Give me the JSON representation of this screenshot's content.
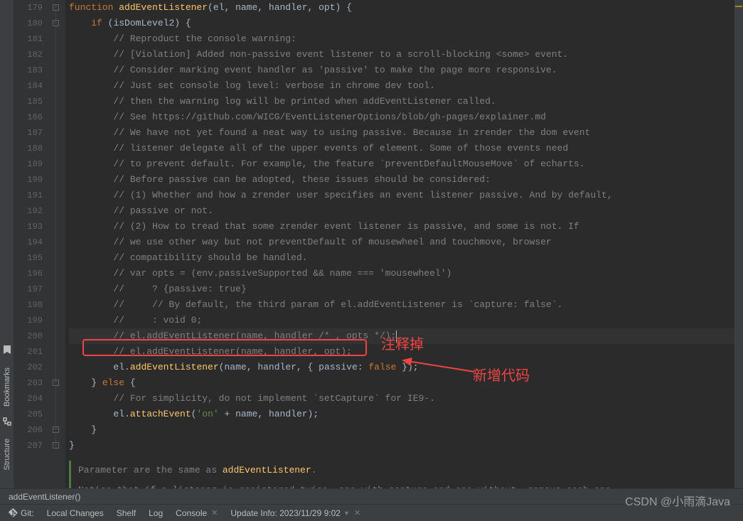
{
  "sidebar": {
    "bookmarks_label": "Bookmarks",
    "structure_label": "Structure"
  },
  "gutter": {
    "start": 179,
    "end": 207
  },
  "code": {
    "lines": [
      {
        "n": 179,
        "ind": 0,
        "t": [
          {
            "c": "kw",
            "v": "function "
          },
          {
            "c": "fn",
            "v": "addEventListener"
          },
          {
            "c": "punct",
            "v": "("
          },
          {
            "c": "param",
            "v": "el"
          },
          {
            "c": "punct",
            "v": ", "
          },
          {
            "c": "param",
            "v": "name"
          },
          {
            "c": "punct",
            "v": ", "
          },
          {
            "c": "param",
            "v": "handler"
          },
          {
            "c": "punct",
            "v": ", "
          },
          {
            "c": "param",
            "v": "opt"
          },
          {
            "c": "punct",
            "v": ") {"
          }
        ]
      },
      {
        "n": 180,
        "ind": 1,
        "t": [
          {
            "c": "kw",
            "v": "if "
          },
          {
            "c": "punct",
            "v": "("
          },
          {
            "c": "param",
            "v": "isDomLevel2"
          },
          {
            "c": "punct",
            "v": ") {"
          }
        ]
      },
      {
        "n": 181,
        "ind": 2,
        "t": [
          {
            "c": "comment",
            "v": "// Reproduct the console warning:"
          }
        ]
      },
      {
        "n": 182,
        "ind": 2,
        "t": [
          {
            "c": "comment",
            "v": "// [Violation] Added non-passive event listener to a scroll-blocking <some> event."
          }
        ]
      },
      {
        "n": 183,
        "ind": 2,
        "t": [
          {
            "c": "comment",
            "v": "// Consider marking event handler as 'passive' to make the page more responsive."
          }
        ]
      },
      {
        "n": 184,
        "ind": 2,
        "t": [
          {
            "c": "comment",
            "v": "// Just set console log level: verbose in chrome dev tool."
          }
        ]
      },
      {
        "n": 185,
        "ind": 2,
        "t": [
          {
            "c": "comment",
            "v": "// then the warning log will be printed when addEventListener called."
          }
        ]
      },
      {
        "n": 186,
        "ind": 2,
        "t": [
          {
            "c": "comment",
            "v": "// See https://github.com/WICG/EventListenerOptions/blob/gh-pages/explainer.md"
          }
        ]
      },
      {
        "n": 187,
        "ind": 2,
        "t": [
          {
            "c": "comment",
            "v": "// We have not yet found a neat way to using passive. Because in zrender the dom event"
          }
        ]
      },
      {
        "n": 188,
        "ind": 2,
        "t": [
          {
            "c": "comment",
            "v": "// listener delegate all of the upper events of element. Some of those events need"
          }
        ]
      },
      {
        "n": 189,
        "ind": 2,
        "t": [
          {
            "c": "comment",
            "v": "// to prevent default. For example, the feature `preventDefaultMouseMove` of echarts."
          }
        ]
      },
      {
        "n": 190,
        "ind": 2,
        "t": [
          {
            "c": "comment",
            "v": "// Before passive can be adopted, these issues should be considered:"
          }
        ]
      },
      {
        "n": 191,
        "ind": 2,
        "t": [
          {
            "c": "comment",
            "v": "// (1) Whether and how a zrender user specifies an event listener passive. And by default,"
          }
        ]
      },
      {
        "n": 192,
        "ind": 2,
        "t": [
          {
            "c": "comment",
            "v": "// passive or not."
          }
        ]
      },
      {
        "n": 193,
        "ind": 2,
        "t": [
          {
            "c": "comment",
            "v": "// (2) How to tread that some zrender event listener is passive, and some is not. If"
          }
        ]
      },
      {
        "n": 194,
        "ind": 2,
        "t": [
          {
            "c": "comment",
            "v": "// we use other way but not preventDefault of mousewheel and touchmove, browser"
          }
        ]
      },
      {
        "n": 195,
        "ind": 2,
        "t": [
          {
            "c": "comment",
            "v": "// compatibility should be handled."
          }
        ]
      },
      {
        "n": 196,
        "ind": 2,
        "t": [
          {
            "c": "comment",
            "v": "// var opts = (env.passiveSupported && name === 'mousewheel')"
          }
        ]
      },
      {
        "n": 197,
        "ind": 2,
        "t": [
          {
            "c": "comment",
            "v": "//     ? {passive: true}"
          }
        ]
      },
      {
        "n": 198,
        "ind": 2,
        "t": [
          {
            "c": "comment",
            "v": "//     // By default, the third param of el.addEventListener is `capture: false`."
          }
        ]
      },
      {
        "n": 199,
        "ind": 2,
        "t": [
          {
            "c": "comment",
            "v": "//     : void 0;"
          }
        ]
      },
      {
        "n": 200,
        "ind": 2,
        "current": true,
        "t": [
          {
            "c": "comment",
            "v": "// el.addEventListener(name, handler /* , opts */);"
          }
        ],
        "cursor": true
      },
      {
        "n": 201,
        "ind": 2,
        "t": [
          {
            "c": "comment",
            "v": "// el.addEventListener(name, handler, opt);"
          }
        ]
      },
      {
        "n": 202,
        "ind": 2,
        "t": [
          {
            "c": "param",
            "v": "el"
          },
          {
            "c": "punct",
            "v": "."
          },
          {
            "c": "fn",
            "v": "addEventListener"
          },
          {
            "c": "punct",
            "v": "("
          },
          {
            "c": "param",
            "v": "name"
          },
          {
            "c": "punct",
            "v": ", "
          },
          {
            "c": "param",
            "v": "handler"
          },
          {
            "c": "punct",
            "v": ", { "
          },
          {
            "c": "param",
            "v": "passive"
          },
          {
            "c": "punct",
            "v": ": "
          },
          {
            "c": "bool",
            "v": "false"
          },
          {
            "c": "punct",
            "v": " });"
          }
        ]
      },
      {
        "n": 203,
        "ind": 1,
        "t": [
          {
            "c": "punct",
            "v": "} "
          },
          {
            "c": "kw",
            "v": "else"
          },
          {
            "c": "punct",
            "v": " {"
          }
        ]
      },
      {
        "n": 204,
        "ind": 2,
        "t": [
          {
            "c": "comment",
            "v": "// For simplicity, do not implement `setCapture` for IE9-."
          }
        ]
      },
      {
        "n": 205,
        "ind": 2,
        "t": [
          {
            "c": "param",
            "v": "el"
          },
          {
            "c": "punct",
            "v": "."
          },
          {
            "c": "fn",
            "v": "attachEvent"
          },
          {
            "c": "punct",
            "v": "("
          },
          {
            "c": "str",
            "v": "'on'"
          },
          {
            "c": "punct",
            "v": " + "
          },
          {
            "c": "param",
            "v": "name"
          },
          {
            "c": "punct",
            "v": ", "
          },
          {
            "c": "param",
            "v": "handler"
          },
          {
            "c": "punct",
            "v": ");"
          }
        ]
      },
      {
        "n": 206,
        "ind": 1,
        "t": [
          {
            "c": "punct",
            "v": "}"
          }
        ]
      },
      {
        "n": 207,
        "ind": 0,
        "t": [
          {
            "c": "punct",
            "v": "}"
          }
        ]
      }
    ]
  },
  "doc": {
    "l1_pre": "Parameter are the same as ",
    "l1_link": "addEventListener",
    "l1_post": ".",
    "l2": "Notice that if a listener is registered twice, one with capture and one without, remove each one"
  },
  "annotations": {
    "comment_out": "注释掉",
    "new_code": "新增代码"
  },
  "breadcrumb": {
    "text": "addEventListener()"
  },
  "status": {
    "git": "Git:",
    "local_changes": "Local Changes",
    "shelf": "Shelf",
    "log": "Log",
    "console": "Console",
    "update_info": "Update Info: 2023/11/29 9:02"
  },
  "watermark": "CSDN @小雨滴Java"
}
